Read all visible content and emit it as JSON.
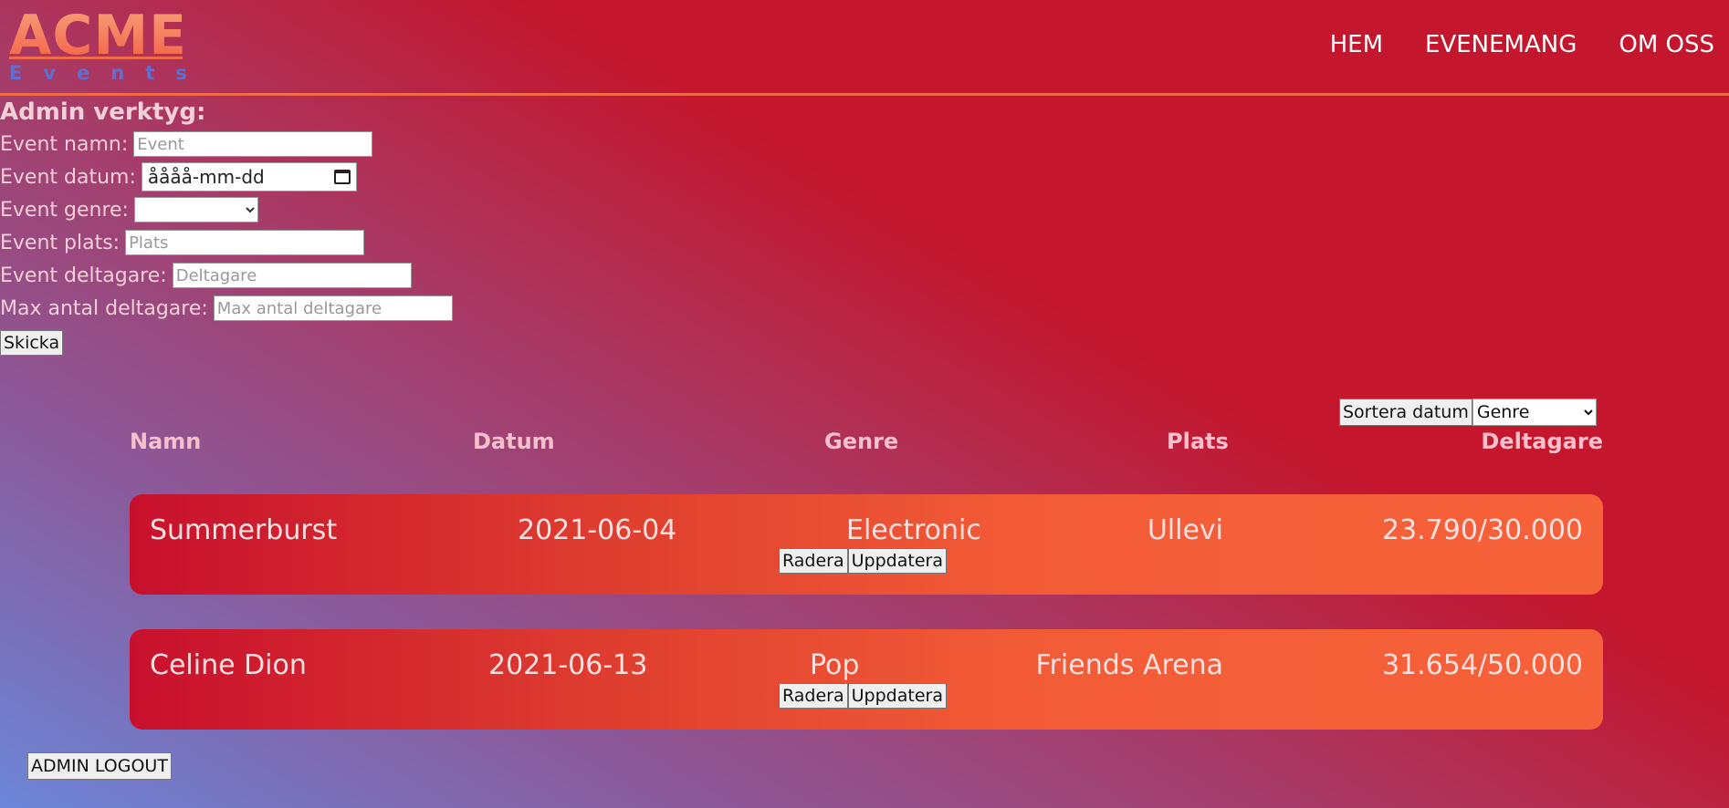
{
  "header": {
    "logo_main": "ACME",
    "logo_sub": "Events",
    "nav": [
      "HEM",
      "EVENEMANG",
      "OM OSS"
    ]
  },
  "admin": {
    "title": "Admin verktyg:",
    "fields": {
      "name_label": "Event namn:",
      "name_placeholder": "Event",
      "date_label": "Event datum:",
      "date_value": "åååå-mm-dd",
      "genre_label": "Event genre:",
      "genre_value": "",
      "place_label": "Event plats:",
      "place_placeholder": "Plats",
      "participants_label": "Event deltagare:",
      "participants_placeholder": "Deltagare",
      "max_label": "Max antal deltagare:",
      "max_placeholder": "Max antal deltagare"
    },
    "submit_label": "Skicka"
  },
  "sort": {
    "button_label": "Sortera datum",
    "genre_selected": "Genre"
  },
  "table": {
    "headers": [
      "Namn",
      "Datum",
      "Genre",
      "Plats",
      "Deltagare"
    ],
    "rows": [
      {
        "name": "Summerburst",
        "date": "2021-06-04",
        "genre": "Electronic",
        "place": "Ullevi",
        "participants": "23.790/30.000"
      },
      {
        "name": "Celine Dion",
        "date": "2021-06-13",
        "genre": "Pop",
        "place": "Friends Arena",
        "participants": "31.654/50.000"
      }
    ],
    "delete_label": "Radera",
    "update_label": "Uppdatera"
  },
  "logout_label": "ADMIN LOGOUT",
  "colors": {
    "accent": "#f26a47",
    "card_start": "#c8102e",
    "card_end": "#f6623a"
  }
}
